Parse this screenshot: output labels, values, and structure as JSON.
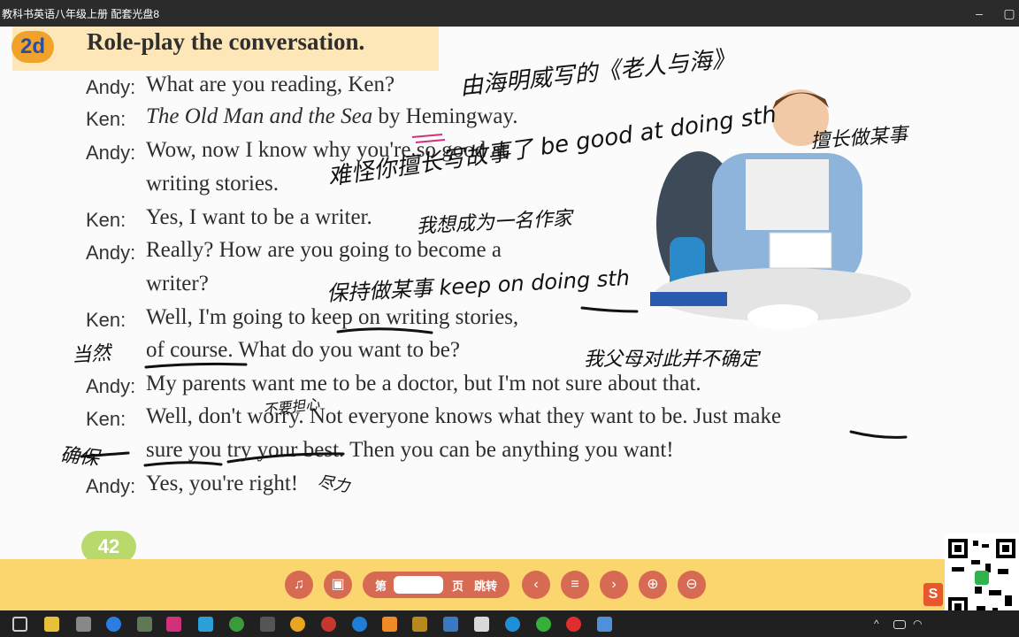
{
  "window": {
    "title": "教科书英语八年级上册 配套光盘8"
  },
  "lesson": {
    "badge": "2d",
    "heading": "Role-play the conversation.",
    "page_number": "42",
    "lines": [
      {
        "speaker": "Andy:",
        "text": "What are you reading, Ken?"
      },
      {
        "speaker": "Ken:",
        "text_italic": "The Old Man and the Sea",
        "text": " by Hemingway."
      },
      {
        "speaker": "Andy:",
        "text": "Wow, now I know why you're so good at"
      },
      {
        "speaker": "",
        "text": "writing stories."
      },
      {
        "speaker": "Ken:",
        "text": "Yes, I want to be a writer."
      },
      {
        "speaker": "Andy:",
        "text": "Really? How are you going to become a"
      },
      {
        "speaker": "",
        "text": "writer?"
      },
      {
        "speaker": "Ken:",
        "text": "Well, I'm going to keep on writing stories,"
      },
      {
        "speaker": "",
        "text": "of course. What do you want to be?"
      },
      {
        "speaker": "Andy:",
        "text": "My parents want me to be a doctor, but I'm not sure about that."
      },
      {
        "speaker": "Ken:",
        "text": "Well, don't worry. Not everyone knows what they want to be. Just make"
      },
      {
        "speaker": "",
        "text": "sure you try your best. Then you can be anything you want!"
      },
      {
        "speaker": "Andy:",
        "text": "Yes, you're right!"
      }
    ]
  },
  "annotations": {
    "note1": "由海明威写的《老人与海》",
    "note2": "难怪你擅长写故事了 be good at doing sth",
    "note3": "擅长做某事",
    "note4": "我想成为一名作家",
    "note5": "保持做某事 keep on doing sth",
    "note6": "当然",
    "note7": "我父母对此并不确定",
    "note8": "不要担心",
    "note9": "确保",
    "note10": "尽力"
  },
  "toolbar": {
    "page_prefix": "第",
    "page_suffix": "页",
    "jump_label": "跳转",
    "page_input_value": "",
    "buttons": [
      "headphones-icon",
      "tv-icon",
      "chevron-left-icon",
      "menu-icon",
      "chevron-right-icon",
      "zoom-in-icon",
      "zoom-out-icon"
    ]
  },
  "colors": {
    "toolbar_bg": "#fbd66f",
    "button_bg": "#d66a52",
    "header_band": "#fde7b8",
    "badge": "#f0a22a"
  }
}
